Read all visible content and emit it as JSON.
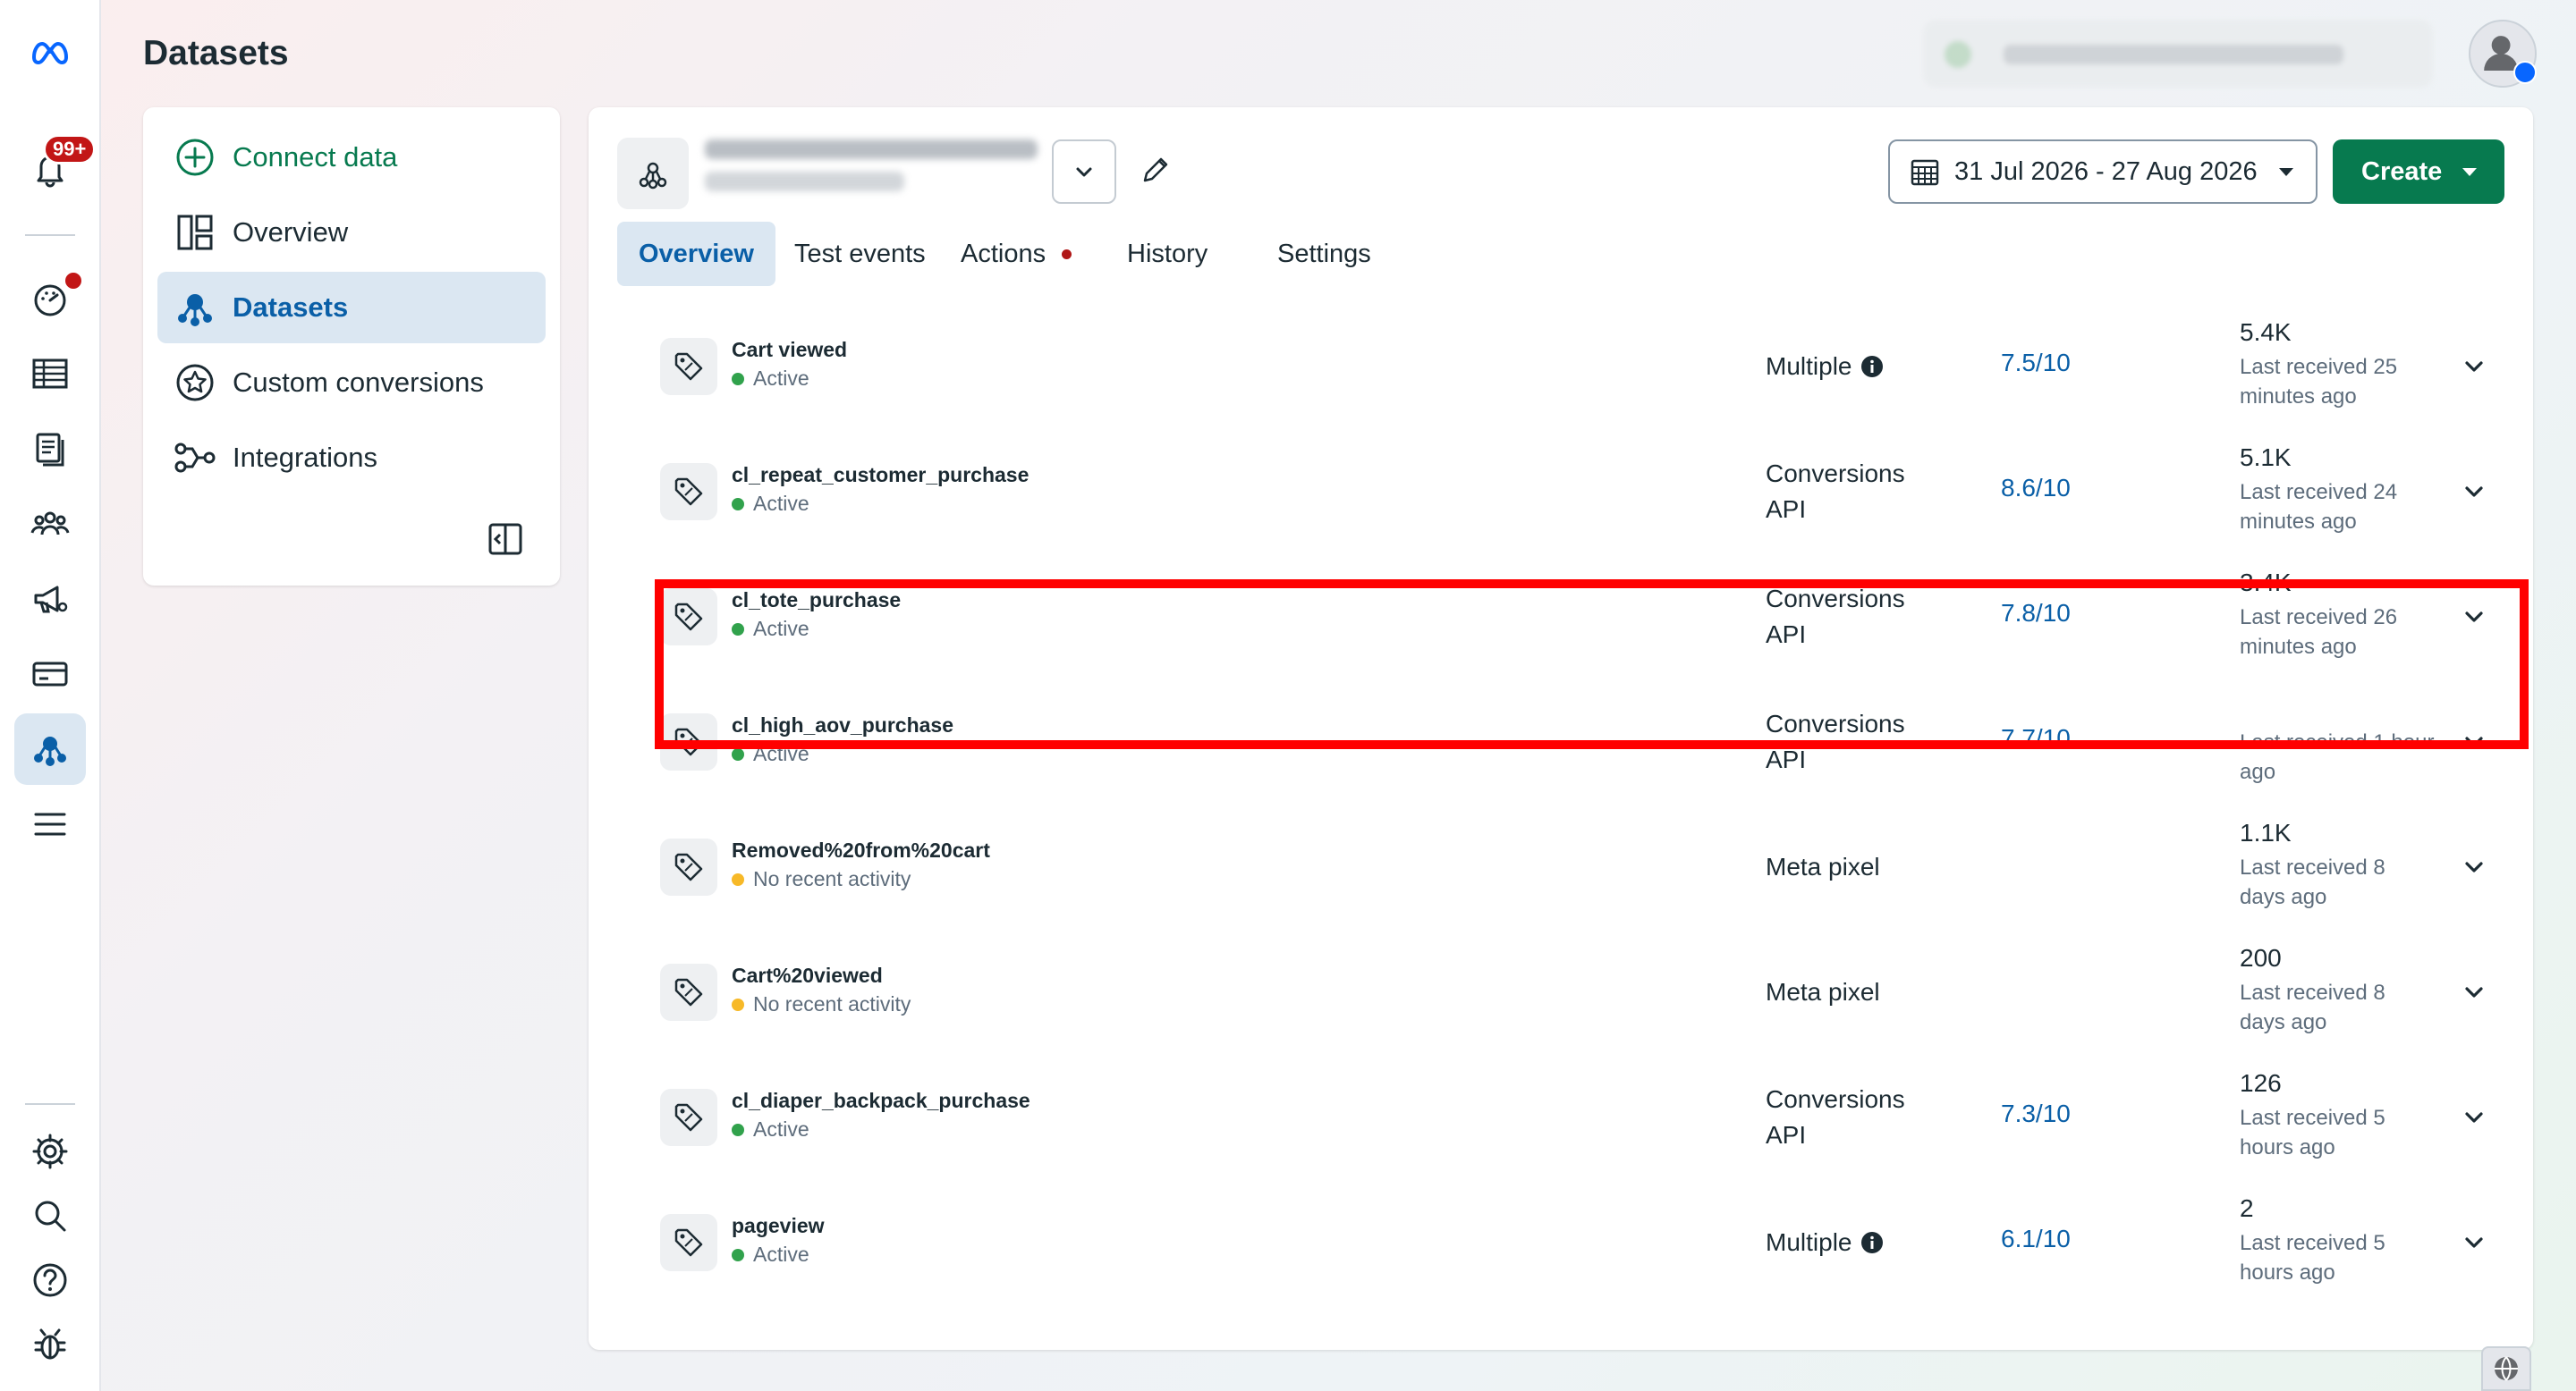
{
  "header": {
    "title": "Datasets"
  },
  "rail": {
    "notification_count": "99+"
  },
  "nav": {
    "connect_data": "Connect data",
    "overview": "Overview",
    "datasets": "Datasets",
    "custom_conversions": "Custom conversions",
    "integrations": "Integrations"
  },
  "toolbar": {
    "date_range": "31 Jul 2026 - 27 Aug 2026",
    "create_label": "Create"
  },
  "tabs": [
    {
      "label": "Overview"
    },
    {
      "label": "Test events"
    },
    {
      "label": "Actions"
    },
    {
      "label": "History"
    },
    {
      "label": "Settings"
    }
  ],
  "events": [
    {
      "name": "Cart viewed",
      "status": "Active",
      "status_color": "#31a24c",
      "source": "Multiple",
      "score": "7.5/10",
      "count": "5.4K",
      "received": "Last received 25 minutes ago"
    },
    {
      "name": "cl_repeat_customer_purchase",
      "status": "Active",
      "status_color": "#31a24c",
      "source": "Conversions API",
      "score": "8.6/10",
      "count": "5.1K",
      "received": "Last received 24 minutes ago"
    },
    {
      "name": "cl_tote_purchase",
      "status": "Active",
      "status_color": "#31a24c",
      "source": "Conversions API",
      "score": "7.8/10",
      "count": "3.4K",
      "received": "Last received 26 minutes ago"
    },
    {
      "name": "cl_high_aov_purchase",
      "status": "Active",
      "status_color": "#31a24c",
      "source": "Conversions API",
      "score": "7.7/10",
      "count": "",
      "received": "Last received 1 hour ago"
    },
    {
      "name": "Removed%20from%20cart",
      "status": "No recent activity",
      "status_color": "#f7b928",
      "source": "Meta pixel",
      "score": "",
      "count": "1.1K",
      "received": "Last received 8 days ago"
    },
    {
      "name": "Cart%20viewed",
      "status": "No recent activity",
      "status_color": "#f7b928",
      "source": "Meta pixel",
      "score": "",
      "count": "200",
      "received": "Last received 8 days ago"
    },
    {
      "name": "cl_diaper_backpack_purchase",
      "status": "Active",
      "status_color": "#31a24c",
      "source": "Conversions API",
      "score": "7.3/10",
      "count": "126",
      "received": "Last received 5 hours ago"
    },
    {
      "name": "pageview",
      "status": "Active",
      "status_color": "#31a24c",
      "source": "Multiple",
      "score": "6.1/10",
      "count": "2",
      "received": "Last received 5 hours ago"
    }
  ],
  "colors": {
    "accent_green": "#077a4f",
    "accent_blue": "#0a5fa7",
    "highlight": "#ff0000",
    "badge_red": "#c21616"
  }
}
